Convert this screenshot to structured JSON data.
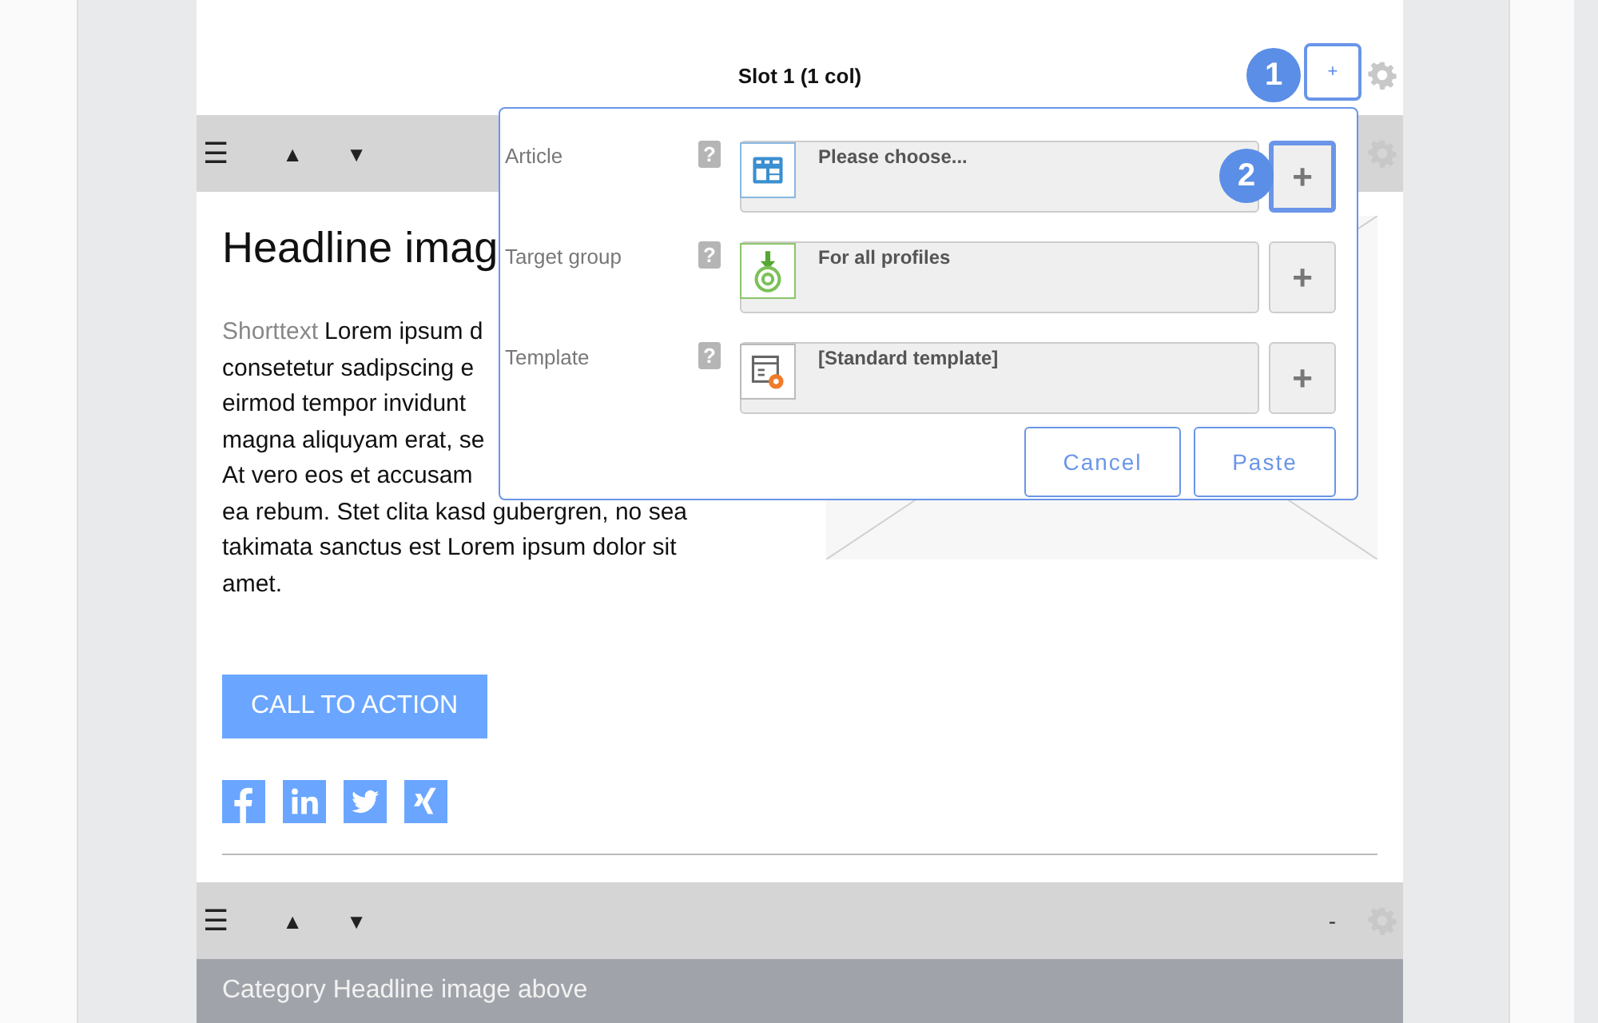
{
  "slot": {
    "title": "Slot 1 (1 col)",
    "add_label": "+"
  },
  "block_toolbar": {
    "menu_glyph": "☰",
    "up_glyph": "▲",
    "down_glyph": "▼"
  },
  "content": {
    "headline": "Headline imag",
    "paragraph_lines": [
      {
        "lead": "Shorttext",
        "text": "Lorem ipsum d"
      },
      {
        "text": "consetetur sadipscing e"
      },
      {
        "text": "eirmod tempor invidunt"
      },
      {
        "text": "magna aliquyam erat, se"
      },
      {
        "text": "At vero eos et accusam"
      },
      {
        "text": "ea rebum. Stet clita kasd gubergren, no sea"
      },
      {
        "text": "takimata sanctus est Lorem ipsum dolor sit"
      },
      {
        "text": "amet."
      }
    ],
    "cta": "CALL TO ACTION",
    "social": [
      {
        "kind": "facebook"
      },
      {
        "kind": "linkedin"
      },
      {
        "kind": "twitter"
      },
      {
        "kind": "xing"
      }
    ]
  },
  "second_toolbar": {
    "menu_glyph": "☰",
    "up_glyph": "▲",
    "down_glyph": "▼",
    "collapse_label": "-"
  },
  "category_bar": {
    "title": "Category Headline image above"
  },
  "dialog": {
    "rows": [
      {
        "label": "Article",
        "help": "?",
        "kind": "article",
        "value": "Please choose...",
        "add": "+"
      },
      {
        "label": "Target group",
        "help": "?",
        "kind": "target",
        "value": "For all profiles",
        "add": "+"
      },
      {
        "label": "Template",
        "help": "?",
        "kind": "template",
        "value": "[Standard template]",
        "add": "+"
      }
    ],
    "buttons": [
      "Cancel",
      "Paste"
    ]
  },
  "callouts": [
    "1",
    "2"
  ]
}
